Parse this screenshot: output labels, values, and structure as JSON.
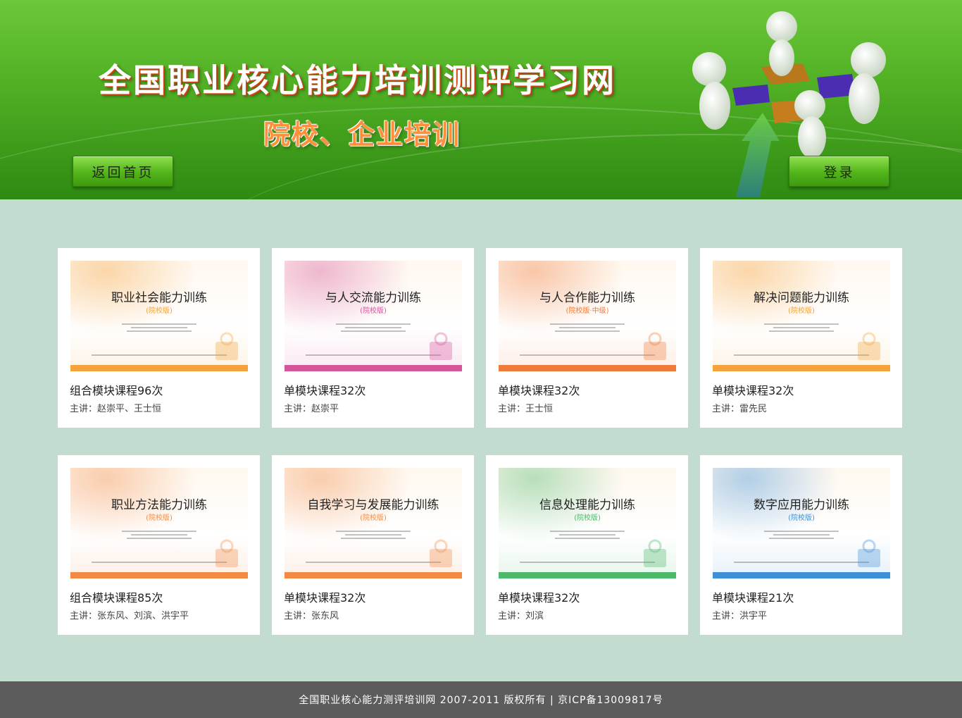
{
  "header": {
    "site_title": "全国职业核心能力培训测评学习网",
    "subtitle": "院校、企业培训",
    "home_button": "返回首页",
    "login_button": "登录"
  },
  "courses": [
    {
      "thumb_title": "职业社会能力训练",
      "edition": "(院校版)",
      "theme": "#f4a23c",
      "title": "组合模块课程96次",
      "teacher": "主讲：赵崇平、王士恒"
    },
    {
      "thumb_title": "与人交流能力训练",
      "edition": "(院校版)",
      "theme": "#d6549a",
      "title": "单模块课程32次",
      "teacher": "主讲：赵崇平"
    },
    {
      "thumb_title": "与人合作能力训练",
      "edition": "(院校版·中级)",
      "theme": "#f07a3a",
      "title": "单模块课程32次",
      "teacher": "主讲：王士恒"
    },
    {
      "thumb_title": "解决问题能力训练",
      "edition": "(院校版)",
      "theme": "#f4a23c",
      "title": "单模块课程32次",
      "teacher": "主讲：雷先民"
    },
    {
      "thumb_title": "职业方法能力训练",
      "edition": "(院校版)",
      "theme": "#f28a46",
      "title": "组合模块课程85次",
      "teacher": "主讲：张东风、刘滨、洪宇平"
    },
    {
      "thumb_title": "自我学习与发展能力训练",
      "edition": "(院校版)",
      "theme": "#f28a46",
      "title": "单模块课程32次",
      "teacher": "主讲：张东风"
    },
    {
      "thumb_title": "信息处理能力训练",
      "edition": "(院校版)",
      "theme": "#4cb86a",
      "title": "单模块课程32次",
      "teacher": "主讲：刘滨"
    },
    {
      "thumb_title": "数字应用能力训练",
      "edition": "(院校版)",
      "theme": "#3f8fd6",
      "title": "单模块课程21次",
      "teacher": "主讲：洪宇平"
    }
  ],
  "footer": {
    "copyright": "全国职业核心能力测评培训网 2007-2011 版权所有 | 京ICP备13009817号"
  }
}
